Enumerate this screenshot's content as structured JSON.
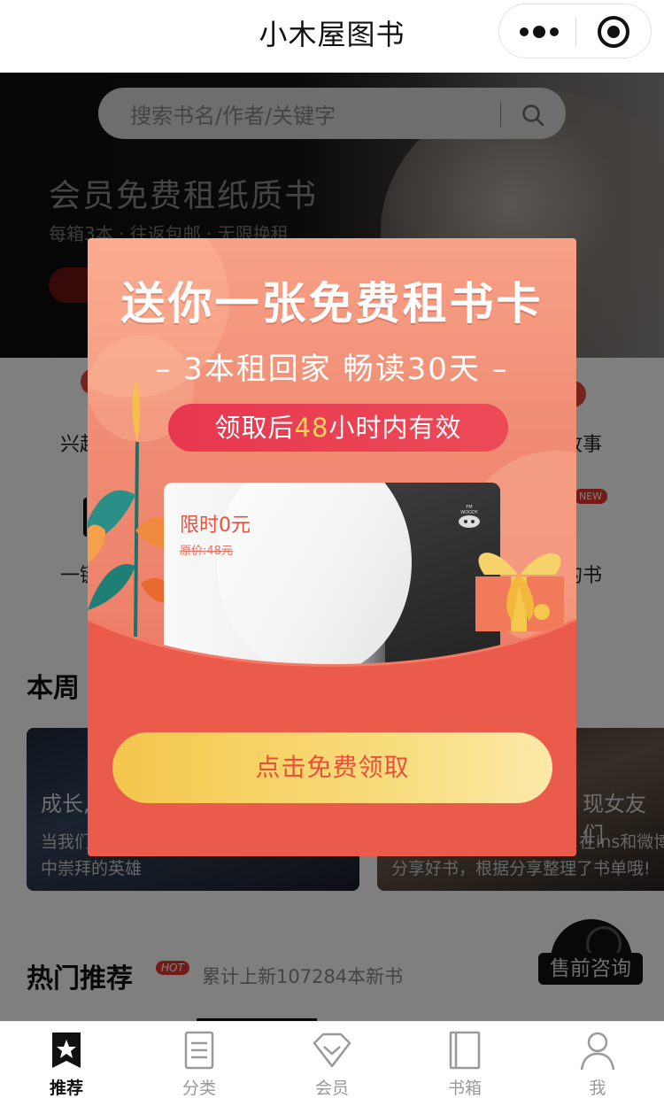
{
  "app": {
    "title": "小木屋图书"
  },
  "search": {
    "placeholder": "搜索书名/作者/关键字"
  },
  "hero": {
    "headline": "会员免费租纸质书",
    "tagline": "每箱3本 · 往返包邮 · 无限换租"
  },
  "grid": {
    "row1_left_partial": "兴起",
    "row1_right_partial": "故事",
    "row2_left_partial": "一键",
    "row2_right_partial": "的书",
    "new_badge": "NEW"
  },
  "weekly": {
    "title_partial": "本周",
    "card1": {
      "title": "成长,",
      "line1": "当我们",
      "line2": "中崇拜的英雄"
    },
    "card2": {
      "title": "现女友们",
      "line1": "在ins和微博",
      "line2": "分享好书，根据分享整理了书单哦!"
    }
  },
  "hot": {
    "title": "热门推荐",
    "badge": "HOT",
    "subtitle": "累计上新107284本新书"
  },
  "consult": {
    "label": "售前咨询"
  },
  "modal": {
    "title": "送你一张免费租书卡",
    "subtitle": "– 3本租回家 畅读30天 –",
    "validity_prefix": "领取后",
    "validity_hours": "48",
    "validity_suffix": "小时内有效",
    "card_price": "限时0元",
    "card_original": "原价:48元",
    "card_brand": "FM WOODY",
    "cta": "点击免费领取"
  },
  "tabbar": [
    {
      "label": "推荐",
      "icon": "star-bookmark-icon",
      "active": true
    },
    {
      "label": "分类",
      "icon": "list-document-icon",
      "active": false
    },
    {
      "label": "会员",
      "icon": "diamond-icon",
      "active": false
    },
    {
      "label": "书箱",
      "icon": "book-box-icon",
      "active": false
    },
    {
      "label": "我",
      "icon": "user-icon",
      "active": false
    }
  ],
  "colors": {
    "accent_red": "#e8503c",
    "modal_top": "#f7a187",
    "cta_gold": "#f4c64c",
    "highlight_yellow": "#ffd25a"
  }
}
